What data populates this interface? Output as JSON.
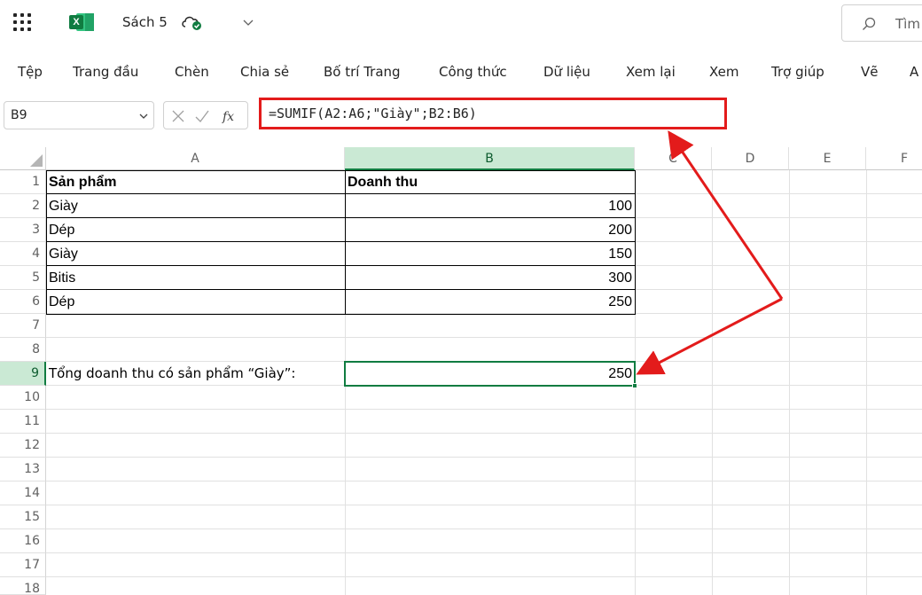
{
  "titlebar": {
    "file_name": "Sách 5",
    "search_label": "Tìm"
  },
  "ribbon": {
    "tabs": [
      "Tệp",
      "Trang đầu",
      "Chèn",
      "Chia sẻ",
      "Bố trí Trang",
      "Công thức",
      "Dữ liệu",
      "Xem lại",
      "Xem",
      "Trợ giúp",
      "Vẽ",
      "A"
    ]
  },
  "formula_bar": {
    "name_box": "B9",
    "fx_label": "fx",
    "formula": "=SUMIF(A2:A6;\"Giày\";B2:B6)"
  },
  "grid": {
    "columns": [
      "A",
      "B",
      "C",
      "D",
      "E",
      "F"
    ],
    "rows": [
      "1",
      "2",
      "3",
      "4",
      "5",
      "6",
      "7",
      "8",
      "9",
      "10",
      "11",
      "12",
      "13",
      "14",
      "15",
      "16",
      "17",
      "18"
    ],
    "selected_column": "B",
    "selected_row": "9",
    "header_row": {
      "a": "Sản phẩm",
      "b": "Doanh thu"
    },
    "data_rows": [
      {
        "product": "Giày",
        "revenue": "100"
      },
      {
        "product": "Dép",
        "revenue": "200"
      },
      {
        "product": "Giày",
        "revenue": "150"
      },
      {
        "product": "Bitis",
        "revenue": "300"
      },
      {
        "product": "Dép",
        "revenue": "250"
      }
    ],
    "summary_label": "Tổng doanh thu có sản phẩm “Giày”:",
    "summary_value": "250"
  },
  "colors": {
    "excel_green": "#107c41",
    "selection_fill": "#cae9d4",
    "annotation_red": "#e31b1b"
  }
}
